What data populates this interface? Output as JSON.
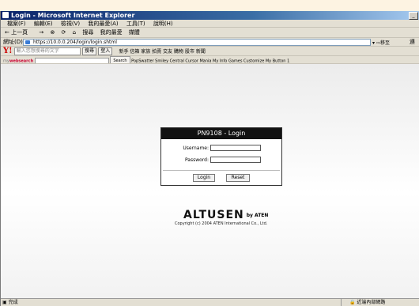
{
  "window": {
    "title": "Login - Microsoft Internet Explorer"
  },
  "menu": [
    "檔案(F)",
    "編輯(E)",
    "檢視(V)",
    "我的最愛(A)",
    "工具(T)",
    "說明(H)"
  ],
  "toolbar": [
    "上一頁",
    "→",
    "搜尋",
    "我的最愛",
    "媒體"
  ],
  "address": {
    "label": "網址(D)",
    "url": "https://10.0.0.204/login/login.shtml",
    "go": "移至",
    "links": "連"
  },
  "yahoo": {
    "logo": "Y!",
    "placeholder": "輸入您想搜尋的文字",
    "search_btn": "搜尋",
    "login_btn": "登入",
    "links": "新手  信箱  家族  拍賣  交友  購物  股市  新聞"
  },
  "websearch": {
    "logo_pre": "my",
    "logo_main": "websearch",
    "search_btn": "Search",
    "links": "PopSwatter  Smiley Central  Cursor Mania  My Info  Games  Customize  My Button 1"
  },
  "login": {
    "title": "PN9108 - Login",
    "username_label": "Username:",
    "password_label": "Password:",
    "login_btn": "Login",
    "reset_btn": "Reset"
  },
  "brand": {
    "name": "ALTUSEN",
    "by": "by ATEN",
    "copyright": "Copyright (c) 2004 ATEN International Co., Ltd."
  },
  "status": {
    "left": "完成",
    "zone": "近端內部網路"
  }
}
